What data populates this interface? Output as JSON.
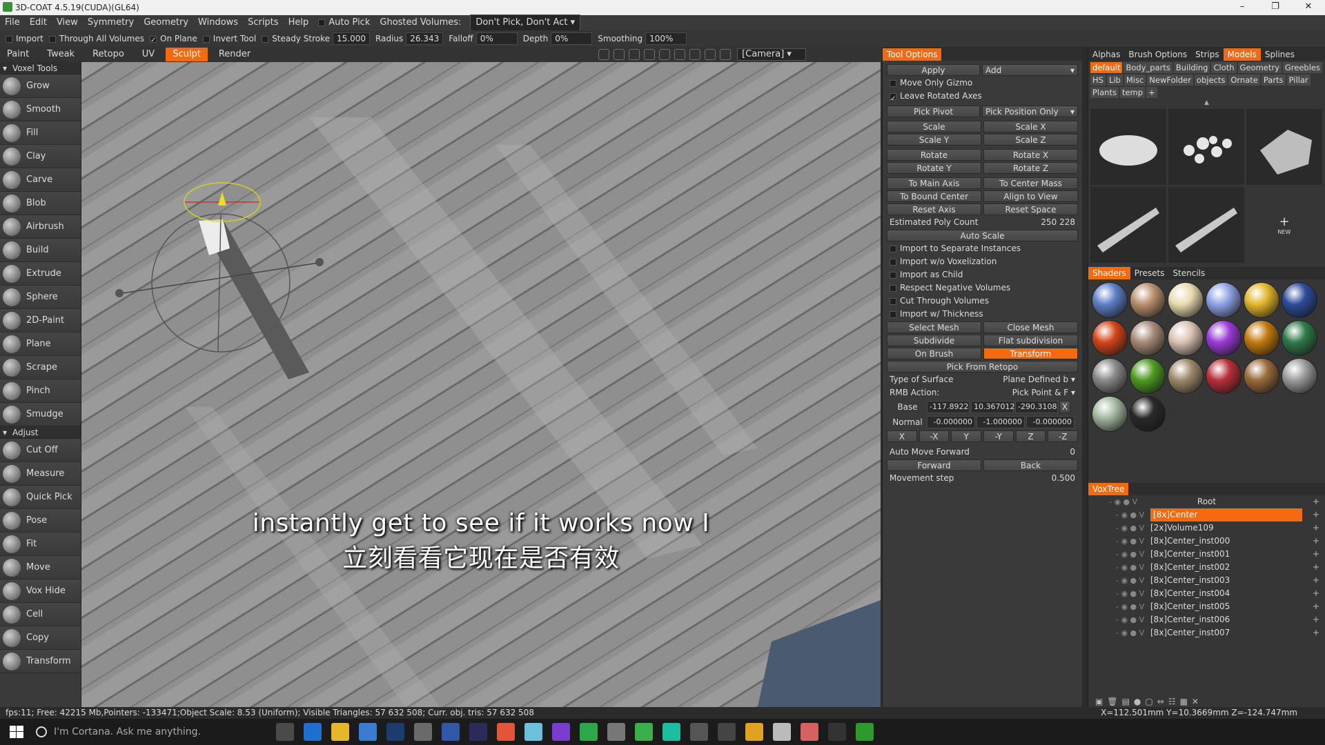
{
  "title_bar": {
    "title": "3D-COAT 4.5.19(CUDA)(GL64)",
    "minimize": "–",
    "maximize": "❐",
    "close": "✕"
  },
  "menu": {
    "items": [
      "File",
      "Edit",
      "View",
      "Symmetry",
      "Geometry",
      "Windows",
      "Scripts",
      "Help"
    ],
    "auto_pick": "Auto Pick",
    "ghosted_label": "Ghosted Volumes:",
    "ghosted_value": "Don't Pick, Don't Act"
  },
  "toolbar": {
    "import": "Import",
    "through_all": "Through All Volumes",
    "on_plane": "On Plane",
    "invert_tool": "Invert Tool",
    "steady_stroke": "Steady Stroke",
    "steady_value": "15.000",
    "radius": "Radius",
    "radius_value": "26.343",
    "falloff": "Falloff",
    "falloff_value": "0%",
    "depth": "Depth",
    "depth_value": "0%",
    "smoothing": "Smoothing",
    "smoothing_value": "100%"
  },
  "rooms": {
    "items": [
      "Paint",
      "Tweak",
      "Retopo",
      "UV",
      "Sculpt",
      "Render"
    ],
    "active": "Sculpt",
    "camera": "[Camera]"
  },
  "left_panel": {
    "voxel_header": "Voxel Tools",
    "voxel_tools": [
      "Grow",
      "Smooth",
      "Fill",
      "Clay",
      "Carve",
      "Blob",
      "Airbrush",
      "Build",
      "Extrude",
      "Sphere",
      "2D-Paint",
      "Plane",
      "Scrape",
      "Pinch",
      "Smudge"
    ],
    "adjust_header": "Adjust",
    "adjust_tools": [
      "Cut Off",
      "Measure",
      "Quick Pick",
      "Pose",
      "Fit",
      "Move",
      "Vox Hide",
      "Cell",
      "Copy",
      "Transform"
    ]
  },
  "viewport": {
    "subtitle_en": "instantly get to see if it works now I",
    "subtitle_zh": "立刻看看它现在是否有效"
  },
  "tool_options": {
    "header": "Tool Options",
    "apply": "Apply",
    "add": "Add",
    "move_only_gizmo": "Move Only Gizmo",
    "leave_rotated_axes": "Leave Rotated Axes",
    "pick_pivot": "Pick Pivot",
    "pick_position_only": "Pick Position Only",
    "scale": "Scale",
    "scale_x": "Scale X",
    "scale_y": "Scale Y",
    "scale_z": "Scale Z",
    "rotate": "Rotate",
    "rotate_x": "Rotate X",
    "rotate_y": "Rotate Y",
    "rotate_z": "Rotate Z",
    "to_main_axis": "To Main Axis",
    "to_center_mass": "To Center Mass",
    "to_bound_center": "To Bound Center",
    "align_to_view": "Align to View",
    "reset_axis": "Reset Axis",
    "reset_space": "Reset Space",
    "est_poly_label": "Estimated Poly Count",
    "est_poly_value": "250 228",
    "auto_scale": "Auto Scale",
    "import_separate": "Import to Separate Instances",
    "import_wo_vox": "Import w/o Voxelization",
    "import_child": "Import as Child",
    "respect_neg": "Respect Negative Volumes",
    "cut_through": "Cut Through Volumes",
    "import_thickness": "Import w/ Thickness",
    "select_mesh": "Select Mesh",
    "close_mesh": "Close Mesh",
    "subdivide": "Subdivide",
    "flat_subdivision": "Flat subdivision",
    "on_brush": "On Brush",
    "transform": "Transform",
    "pick_from_retopo": "Pick From Retopo",
    "type_surface_label": "Type of Surface",
    "type_surface_value": "Plane Defined b",
    "rmb_action_label": "RMB Action:",
    "rmb_action_value": "Pick Point & F",
    "base_label": "Base",
    "base_x": "-117.8922",
    "base_y": "10.367012",
    "base_z": "-290.3108",
    "base_clear": "X",
    "normal_label": "Normal",
    "normal_x": "-0.000000",
    "normal_y": "-1.000000",
    "normal_z": "-0.000000",
    "axes": [
      "X",
      "-X",
      "Y",
      "-Y",
      "Z",
      "-Z"
    ],
    "auto_move_label": "Auto Move Forward",
    "auto_move_value": "0",
    "forward": "Forward",
    "back": "Back",
    "movement_step_label": "Movement step",
    "movement_step_value": "0.500"
  },
  "right_panel": {
    "tabs": [
      "Alphas",
      "Brush Options",
      "Strips",
      "Models",
      "Splines"
    ],
    "active_tab": "Models",
    "folders": [
      "default",
      "Body_parts",
      "Building",
      "Cloth",
      "Geometry",
      "Greebles",
      "HS",
      "Lib",
      "Misc",
      "NewFolder",
      "objects",
      "Ornate",
      "Parts",
      "Pillar",
      "Plants",
      "temp",
      "+"
    ],
    "active_folder": "default",
    "new_label": "NEW",
    "shader_tabs": [
      "Shaders",
      "Presets",
      "Stencils"
    ],
    "active_shader_tab": "Shaders",
    "shader_colors": [
      "#5e7fc7",
      "#b8906e",
      "#e8dcb0",
      "#8fa2e6",
      "#e2b72c",
      "#2d4c9a",
      "#d2451a",
      "#a68b78",
      "#d9c2b4",
      "#9b3bd6",
      "#c27a10",
      "#2f7a4a",
      "#8a8a8a",
      "#4f9a22",
      "#9e8a6a",
      "#b8303a",
      "#9a6a3a",
      "#9c9c9c",
      "#a4b8a0",
      "#2a2a2a"
    ],
    "voxtree_header": "VoxTree",
    "voxtree_root": "Root",
    "voxtree_items": [
      "[8x]Center",
      "[2x]Volume109",
      "[8x]Center_inst000",
      "[8x]Center_inst001",
      "[8x]Center_inst002",
      "[8x]Center_inst003",
      "[8x]Center_inst004",
      "[8x]Center_inst005",
      "[8x]Center_inst006",
      "[8x]Center_inst007"
    ],
    "voxtree_selected": "[8x]Center"
  },
  "status": {
    "left": "fps:11;    Free: 42215 Mb,Pointers: -133471;Object Scale: 8.53 (Uniform); Visible Triangles: 57 632 508; Curr. obj. tris: 57 632 508",
    "right": "X=112.501mm  Y=10.3669mm  Z=-124.747mm"
  },
  "taskbar": {
    "cortana": "I'm Cortana. Ask me anything.",
    "app_colors": [
      "#4a4a4a",
      "#1f6fd1",
      "#e5b72a",
      "#3a7bd5",
      "#1d3c6e",
      "#6a6a6a",
      "#3357a8",
      "#2b2b5a",
      "#e2553a",
      "#6ac1d9",
      "#7a3bd0",
      "#2aa84a",
      "#777",
      "#3ab04a",
      "#1bbfa0",
      "#555",
      "#444",
      "#e0a020",
      "#bbb",
      "#d86060",
      "#333",
      "#2e9a2e"
    ]
  },
  "colors": {
    "accent": "#f26b10",
    "panel": "#3a3a3a",
    "viewport": "#8e8e8e"
  }
}
